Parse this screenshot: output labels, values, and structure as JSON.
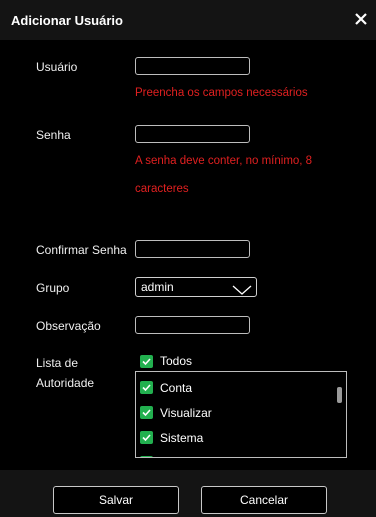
{
  "dialog": {
    "title": "Adicionar Usuário"
  },
  "form": {
    "username": {
      "label": "Usuário",
      "value": "",
      "error": "Preencha os campos necessários"
    },
    "password": {
      "label": "Senha",
      "value": "",
      "error_line1": "A senha deve conter, no mínimo, 8",
      "error_line2": "caracteres"
    },
    "confirm": {
      "label": "Confirmar Senha",
      "value": ""
    },
    "group": {
      "label": "Grupo",
      "value": "admin"
    },
    "note": {
      "label": "Observação",
      "value": ""
    },
    "authority": {
      "label_line1": "Lista de",
      "label_line2": "Autoridade",
      "all_label": "Todos",
      "all_checked": true,
      "items": [
        {
          "label": "Conta",
          "checked": true
        },
        {
          "label": "Visualizar",
          "checked": true
        },
        {
          "label": "Sistema",
          "checked": true
        }
      ]
    }
  },
  "footer": {
    "save_label": "Salvar",
    "cancel_label": "Cancelar"
  },
  "colors": {
    "checkbox": "#22b04f",
    "error": "#e02020",
    "header_bg": "#141414"
  },
  "icons": {
    "close": "close-icon",
    "dropdown": "chevron-down-icon",
    "check": "check-icon"
  }
}
